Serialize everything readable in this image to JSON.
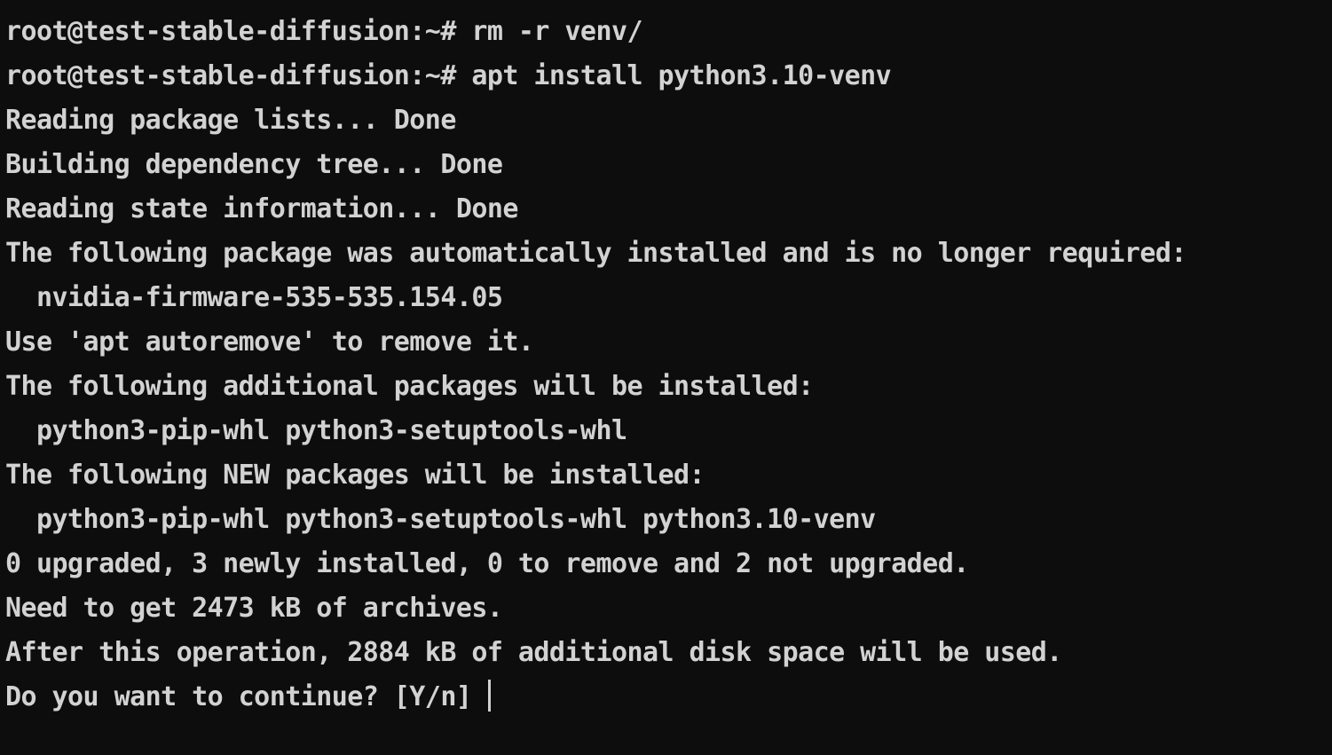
{
  "terminal": {
    "background_color": "#0d0d0d",
    "foreground_color": "#d2d2d2",
    "hostname": "test-stable-diffusion",
    "user": "root",
    "prompt_symbol": "root@test-stable-diffusion:~#",
    "cursor": {
      "style": "vertical-bar",
      "visible": true,
      "color": "#d2d2d2"
    },
    "lines": [
      "root@test-stable-diffusion:~# rm -r venv/",
      "root@test-stable-diffusion:~# apt install python3.10-venv",
      "Reading package lists... Done",
      "Building dependency tree... Done",
      "Reading state information... Done",
      "The following package was automatically installed and is no longer required:",
      "  nvidia-firmware-535-535.154.05",
      "Use 'apt autoremove' to remove it.",
      "The following additional packages will be installed:",
      "  python3-pip-whl python3-setuptools-whl",
      "The following NEW packages will be installed:",
      "  python3-pip-whl python3-setuptools-whl python3.10-venv",
      "0 upgraded, 3 newly installed, 0 to remove and 2 not upgraded.",
      "Need to get 2473 kB of archives.",
      "After this operation, 2884 kB of additional disk space will be used.",
      "Do you want to continue? [Y/n] "
    ],
    "commands": [
      "rm -r venv/",
      "apt install python3.10-venv"
    ],
    "summary": {
      "upgraded": 0,
      "newly_installed": 3,
      "to_remove": 0,
      "not_upgraded": 2,
      "download_size": "2473 kB",
      "disk_space_used": "2884 kB"
    },
    "packages": {
      "autoremovable": [
        "nvidia-firmware-535-535.154.05"
      ],
      "additional": [
        "python3-pip-whl",
        "python3-setuptools-whl"
      ],
      "new": [
        "python3-pip-whl",
        "python3-setuptools-whl",
        "python3.10-venv"
      ]
    },
    "confirmation_prompt": "Do you want to continue? [Y/n]"
  }
}
